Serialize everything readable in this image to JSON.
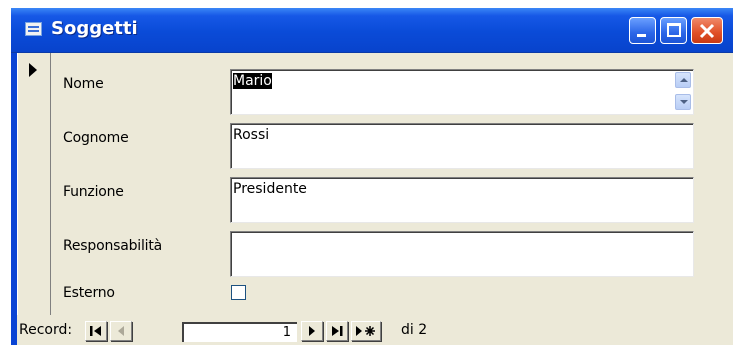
{
  "window": {
    "title": "Soggetti",
    "icon": "form-icon"
  },
  "fields": {
    "nome": {
      "label": "Nome",
      "value": "Mario"
    },
    "cognome": {
      "label": "Cognome",
      "value": "Rossi"
    },
    "funzione": {
      "label": "Funzione",
      "value": "Presidente"
    },
    "responsabilita": {
      "label": "Responsabilità",
      "value": ""
    },
    "esterno": {
      "label": "Esterno",
      "checked": false
    }
  },
  "navigation": {
    "label": "Record:",
    "current": "1",
    "total_text": "di 2"
  },
  "colors": {
    "titlebar": "#0a4bd8",
    "client_bg": "#ece9d8",
    "close_button": "#e04f26"
  }
}
